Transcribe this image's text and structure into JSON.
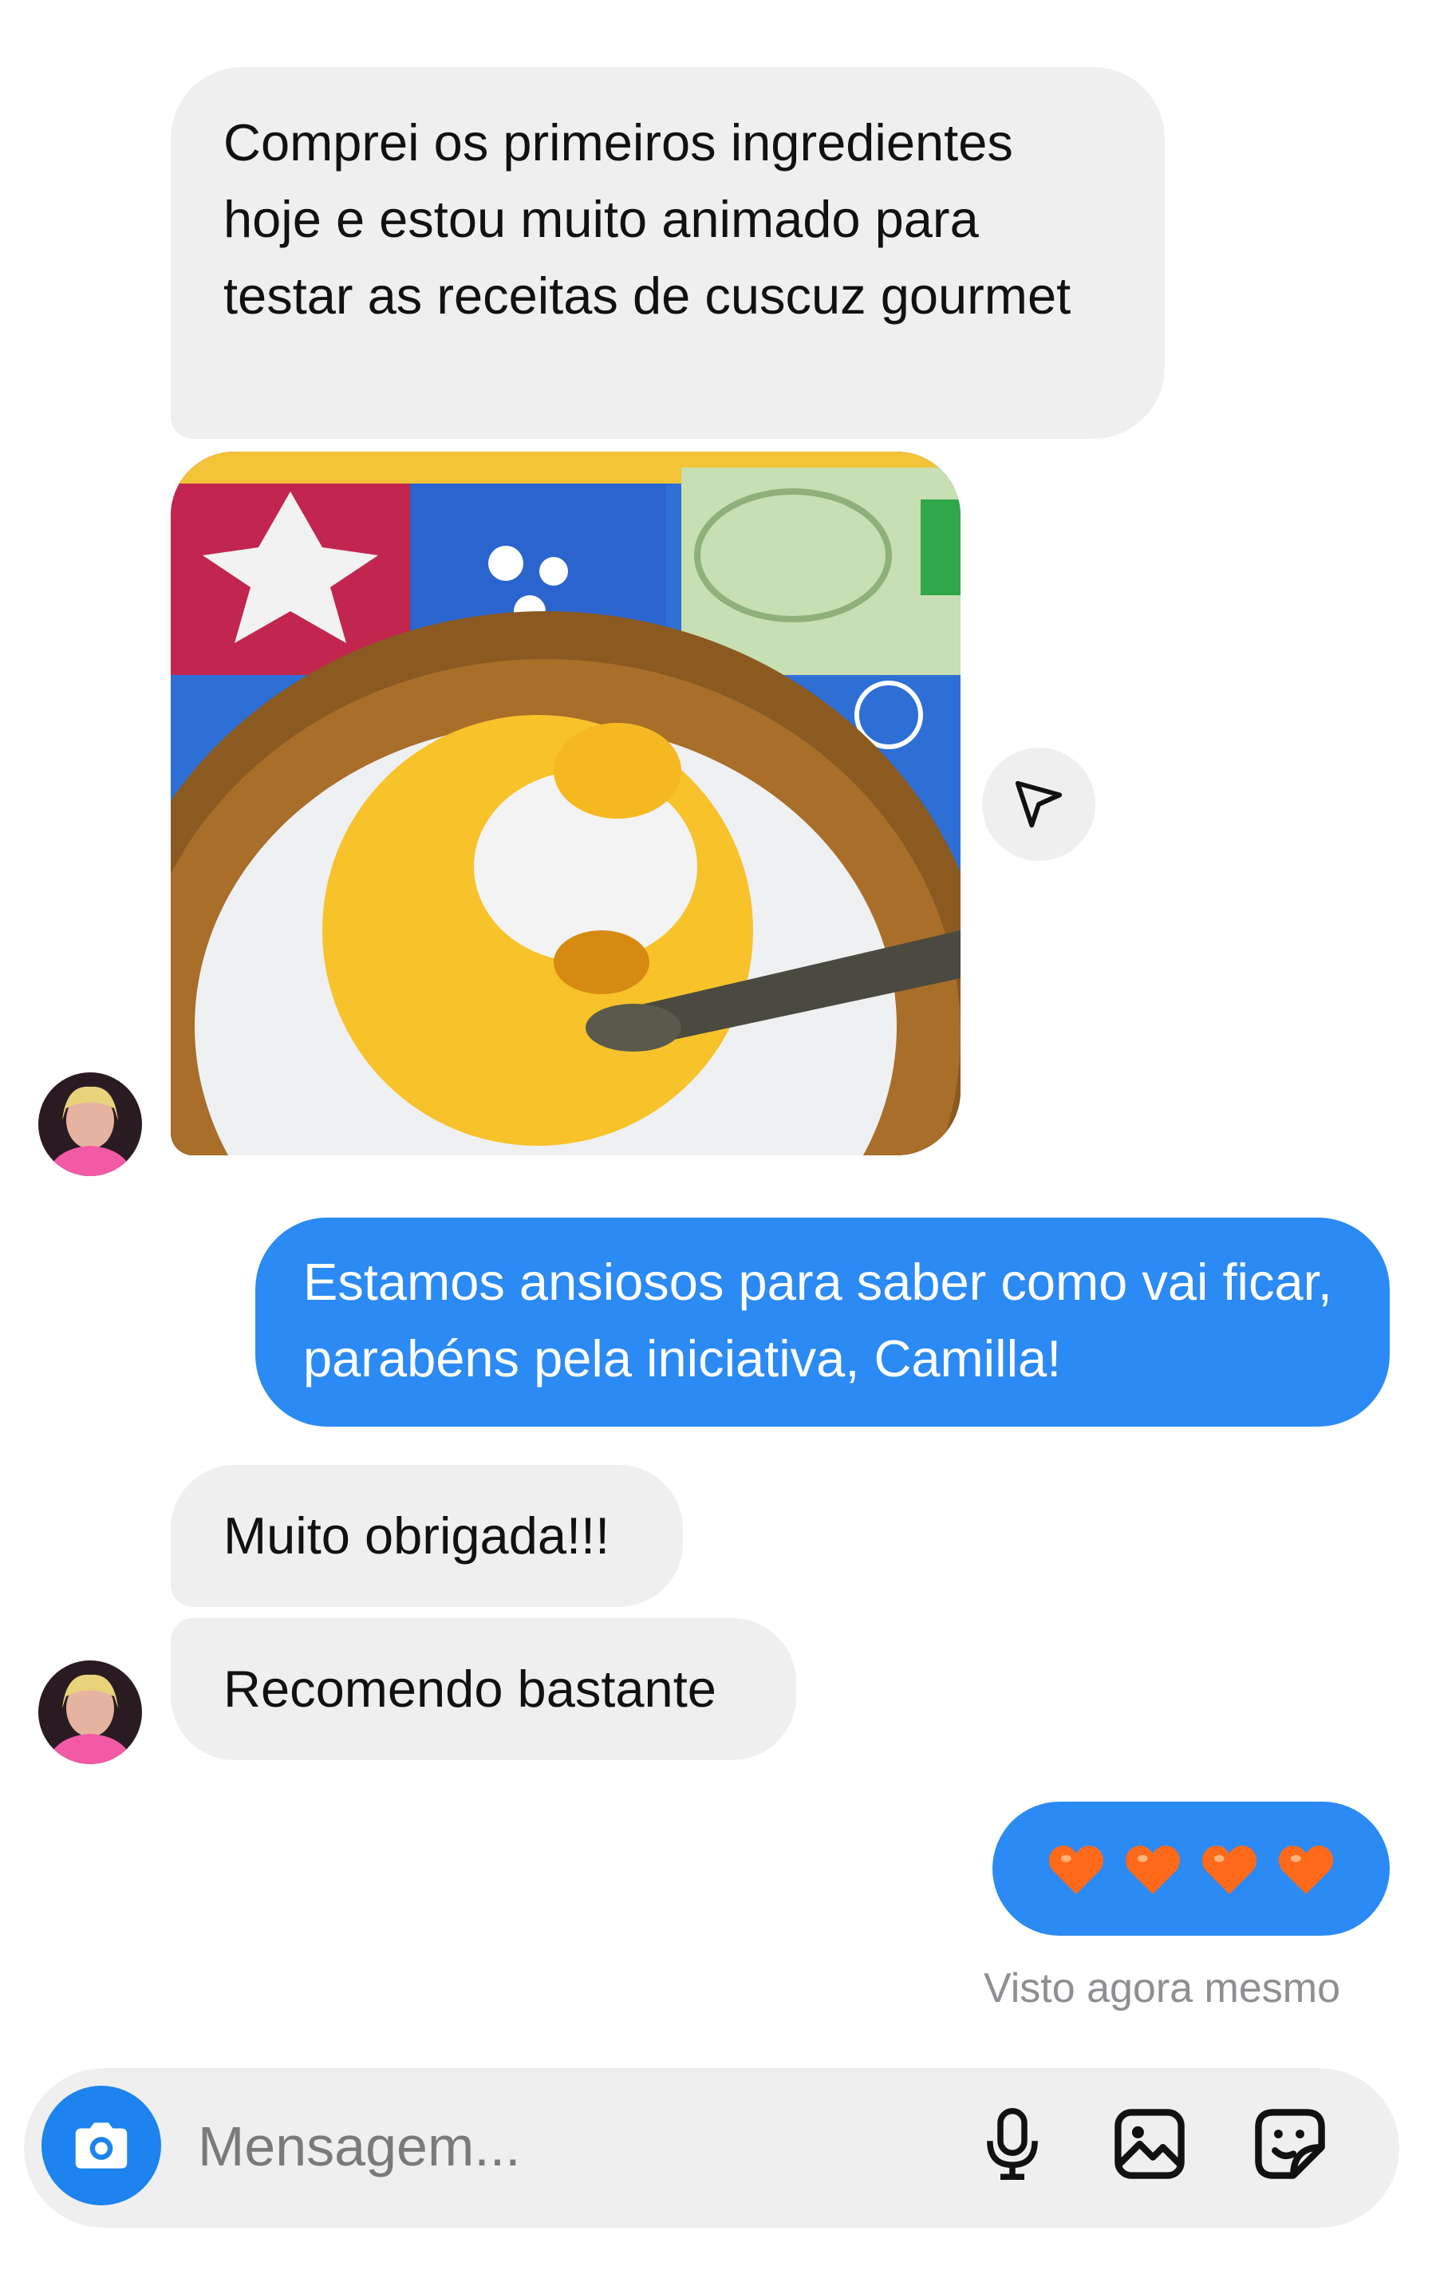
{
  "conversation": {
    "messages": [
      {
        "from": "them",
        "type": "text",
        "text": "Comprei os primeiros ingredientes hoje e estou muito animado para testar as receitas de cuscuz gourmet"
      },
      {
        "from": "them",
        "type": "image",
        "image_subject": "photo of couscous with egg yolk on a plate, with a spoon"
      },
      {
        "from": "me",
        "type": "text",
        "text": "Estamos ansiosos para saber como vai ficar, parabéns pela iniciativa, Camilla!"
      },
      {
        "from": "them",
        "type": "text",
        "text": "Muito obrigada!!!"
      },
      {
        "from": "them",
        "type": "text",
        "text": "Recomendo bastante"
      },
      {
        "from": "me",
        "type": "emoji",
        "emoji": [
          "orange-heart",
          "orange-heart",
          "orange-heart",
          "orange-heart"
        ]
      }
    ],
    "seen_status": "Visto agora mesmo"
  },
  "icons": {
    "share": "paper-plane-icon",
    "camera": "camera-icon",
    "microphone": "microphone-icon",
    "gallery": "image-icon",
    "sticker": "sticker-icon"
  },
  "composer": {
    "placeholder": "Mensagem..."
  },
  "colors": {
    "incoming_bubble": "#efefef",
    "outgoing_bubble": "#2b8af4",
    "accent_camera": "#1d83ee",
    "heart": "#ff6a1a",
    "seen_text": "#8e8e93"
  }
}
